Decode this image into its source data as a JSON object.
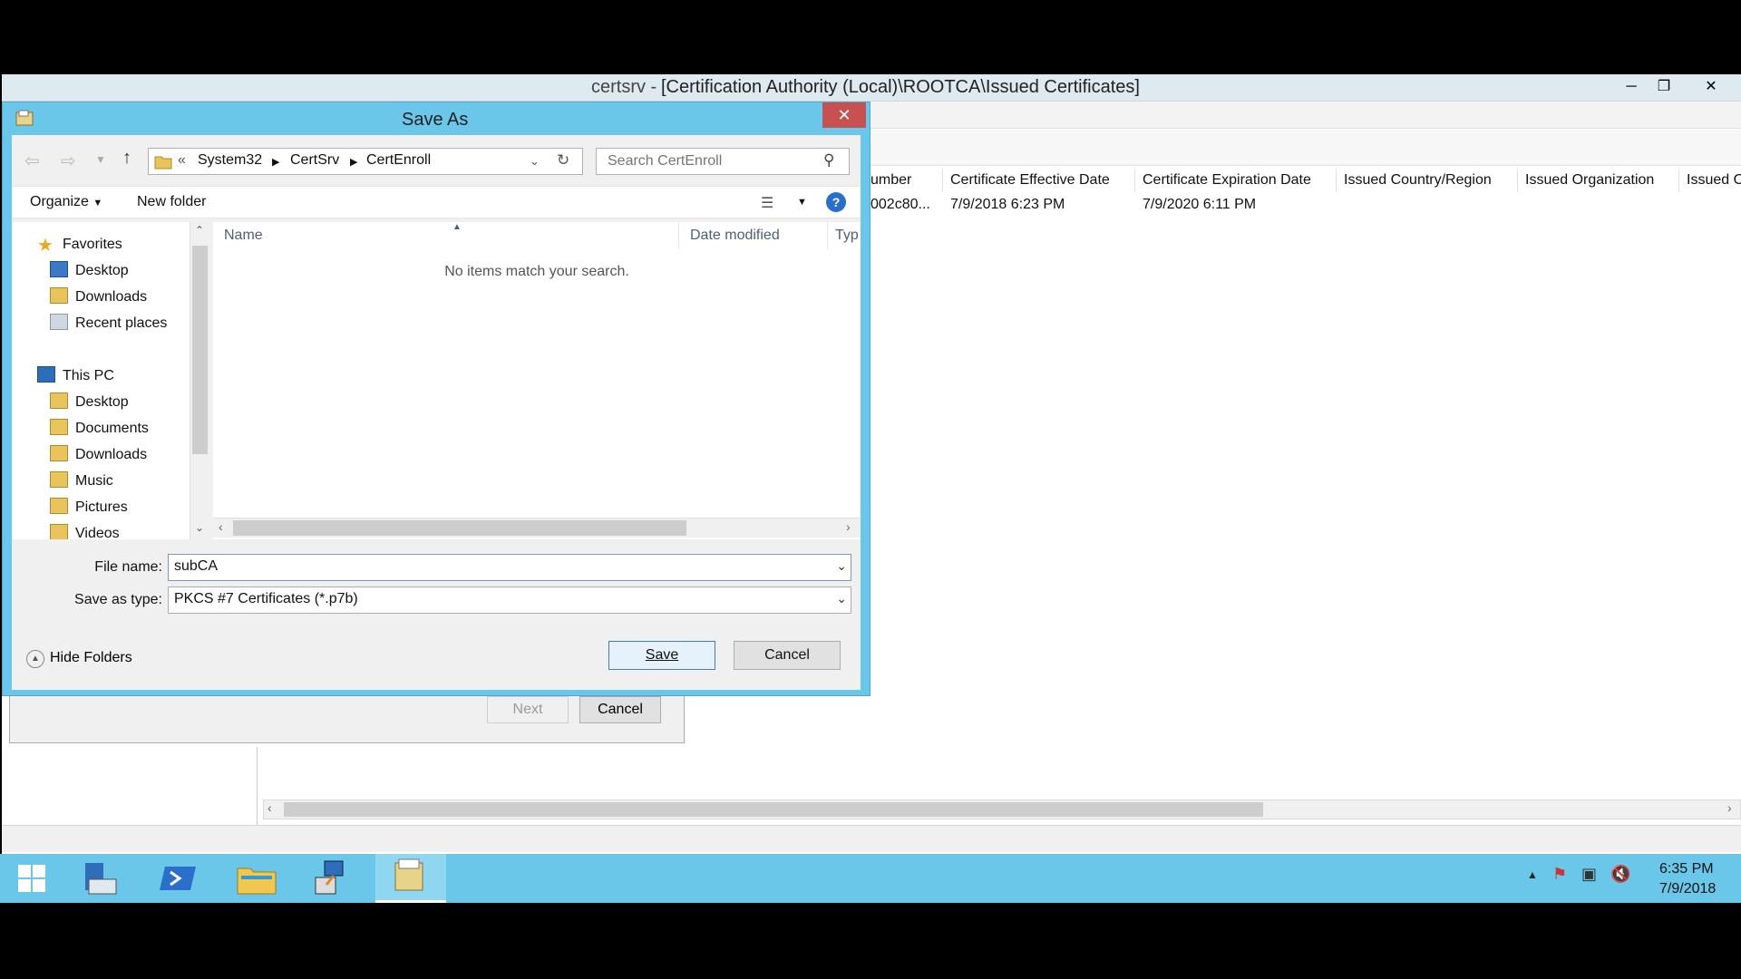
{
  "mmc": {
    "title": "[Certification Authority (Local)\\ROOTCA\\Issued Certificates]",
    "title_prefix": "certsrv -",
    "columns": [
      "umber",
      "Certificate Effective Date",
      "Certificate Expiration Date",
      "Issued Country/Region",
      "Issued Organization",
      "Issued Or"
    ],
    "rows": [
      [
        "002c80...",
        "7/9/2018 6:23 PM",
        "7/9/2020 6:11 PM",
        "",
        "",
        ""
      ]
    ]
  },
  "wizard": {
    "next_label": "Next",
    "cancel_label": "Cancel"
  },
  "dialog": {
    "title": "Save As",
    "breadcrumb": [
      "System32",
      "CertSrv",
      "CertEnroll"
    ],
    "search_placeholder": "Search CertEnroll",
    "organize_label": "Organize",
    "new_folder_label": "New folder",
    "nav": {
      "favorites_label": "Favorites",
      "favorites": [
        "Desktop",
        "Downloads",
        "Recent places"
      ],
      "this_pc_label": "This PC",
      "this_pc": [
        "Desktop",
        "Documents",
        "Downloads",
        "Music",
        "Pictures",
        "Videos"
      ]
    },
    "list_columns": [
      "Name",
      "Date modified",
      "Typ"
    ],
    "empty_message": "No items match your search.",
    "file_name_label": "File name:",
    "file_name_value": "subCA",
    "save_type_label": "Save as type:",
    "save_type_value": "PKCS #7 Certificates (*.p7b)",
    "hide_folders_label": "Hide Folders",
    "save_label": "Save",
    "cancel_label": "Cancel"
  },
  "taskbar": {
    "time": "6:35 PM",
    "date": "7/9/2018"
  },
  "colors": {
    "accent": "#6ac7ea",
    "close": "#c75050"
  }
}
